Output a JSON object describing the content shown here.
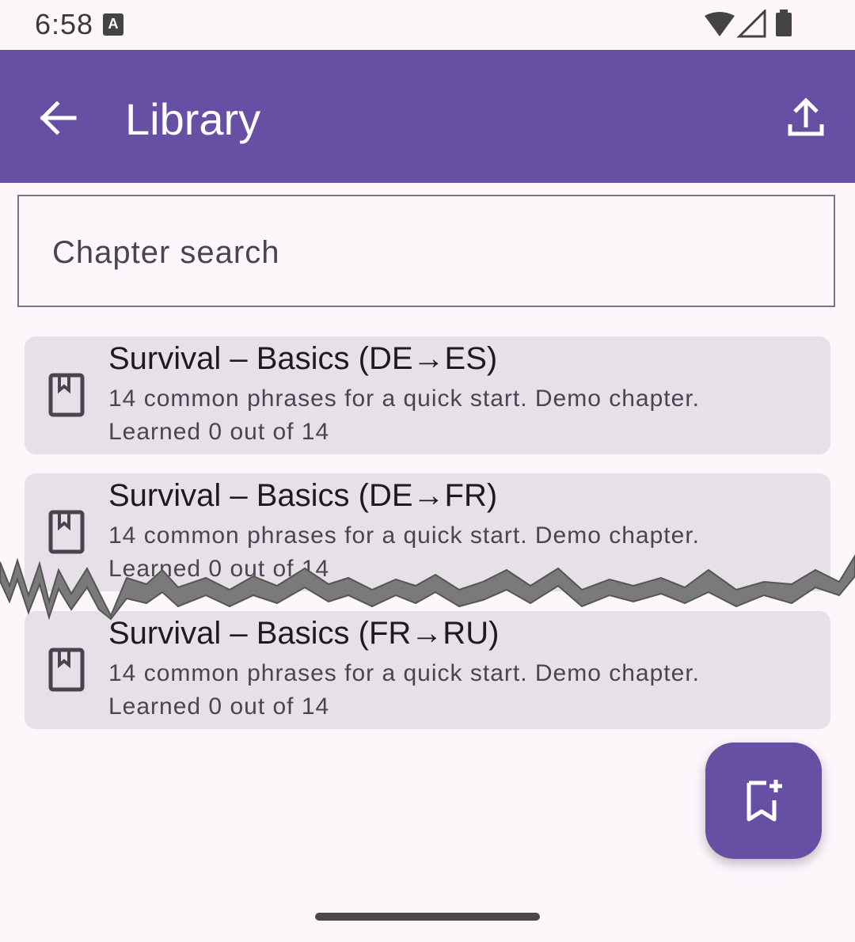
{
  "status_bar": {
    "time": "6:58",
    "notification_icon": "A",
    "icons": [
      "wifi-icon",
      "signal-icon",
      "battery-icon"
    ]
  },
  "app_bar": {
    "title": "Library",
    "back_icon": "arrow-back-icon",
    "action_icon": "upload-icon"
  },
  "search": {
    "placeholder": "Chapter search",
    "value": ""
  },
  "chapters": [
    {
      "title": "Survival – Basics (DE→ES)",
      "description": "14 common phrases for a quick start. Demo chapter.",
      "progress": "Learned 0 out of 14",
      "icon": "book-icon"
    },
    {
      "title": "Survival – Basics (DE→FR)",
      "description": "14 common phrases for a quick start. Demo chapter.",
      "progress": "Learned 0 out of 14",
      "icon": "book-icon"
    },
    {
      "title": "Survival – Basics (FR→RU)",
      "description": "14 common phrases for a quick start. Demo chapter.",
      "progress": "Learned 0 out of 14",
      "icon": "book-icon"
    }
  ],
  "fab": {
    "icon": "bookmark-add-icon"
  },
  "colors": {
    "primary": "#674fa3",
    "background": "#fdf7fc",
    "card": "#e7e0e8"
  }
}
